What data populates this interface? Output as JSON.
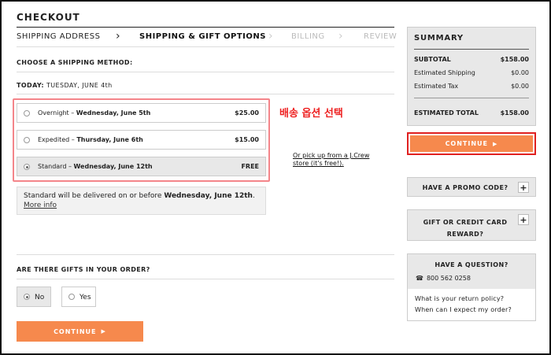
{
  "page": {
    "title": "CHECKOUT"
  },
  "steps": [
    {
      "label": "SHIPPING ADDRESS",
      "state": "done"
    },
    {
      "label": "SHIPPING & GIFT OPTIONS",
      "state": "active"
    },
    {
      "label": "BILLING",
      "state": "future"
    },
    {
      "label": "REVIEW",
      "state": "future"
    }
  ],
  "shipping": {
    "heading": "CHOOSE A SHIPPING METHOD:",
    "today_label": "TODAY:",
    "today_value": "TUESDAY, JUNE 4th",
    "options": [
      {
        "name": "Overnight",
        "date": "Wednesday, June 5th",
        "price": "$25.00",
        "selected": false
      },
      {
        "name": "Expedited",
        "date": "Thursday, June 6th",
        "price": "$15.00",
        "selected": false
      },
      {
        "name": "Standard",
        "date": "Wednesday, June 12th",
        "price": "FREE",
        "selected": true
      }
    ],
    "separator": " – ",
    "annotation": "배송 옵션 선택",
    "pickup_link": "Or pick up from a J.Crew store (it's free!).",
    "delivery_prefix": "Standard will be delivered on or before ",
    "delivery_date": "Wednesday, June 12th",
    "delivery_suffix": ".",
    "more_info": "More info"
  },
  "gifts": {
    "question": "ARE THERE GIFTS IN YOUR ORDER?",
    "no_label": "No",
    "yes_label": "Yes",
    "selected": "No"
  },
  "buttons": {
    "continue": "CONTINUE",
    "arrow": "▶"
  },
  "summary": {
    "title": "SUMMARY",
    "rows": [
      {
        "label": "SUBTOTAL",
        "value": "$158.00"
      },
      {
        "label": "Estimated Shipping",
        "value": "$0.00"
      },
      {
        "label": "Estimated Tax",
        "value": "$0.00"
      }
    ],
    "total_label": "ESTIMATED TOTAL",
    "total_value": "$158.00"
  },
  "promo": {
    "label": "HAVE A PROMO CODE?",
    "plus": "+"
  },
  "giftcard": {
    "line1": "GIFT OR CREDIT CARD",
    "line2": "REWARD?",
    "plus": "+"
  },
  "help": {
    "title": "HAVE A QUESTION?",
    "phone": "800 562 0258",
    "phone_icon": "☎",
    "faqs": [
      "What is your return policy?",
      "When can I expect my order?"
    ]
  },
  "colors": {
    "accent": "#f6894d",
    "annotation": "#ee2222",
    "highlight_border": "#f4858a"
  }
}
